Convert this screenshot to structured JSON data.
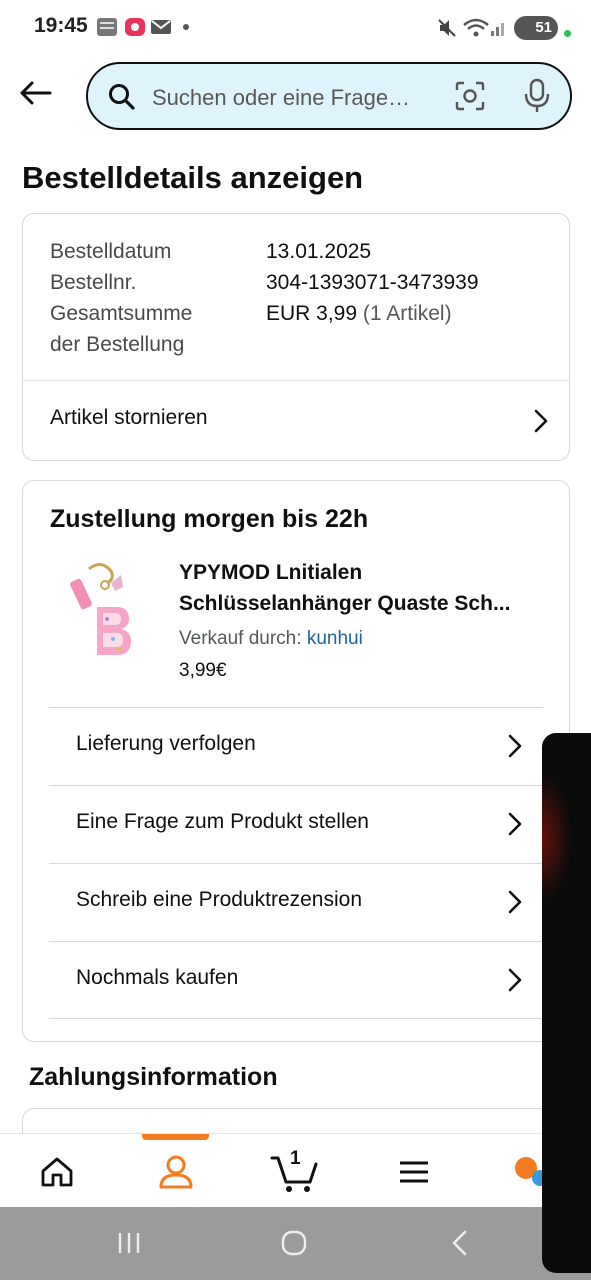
{
  "status_bar": {
    "time": "19:45",
    "battery": "51",
    "icons": [
      "news-icon",
      "video-app-icon",
      "mail-icon",
      "dot-icon",
      "mute-icon",
      "wifi-icon",
      "signal-icon",
      "battery-icon"
    ]
  },
  "header": {
    "search_placeholder": "Suchen oder eine Frage…"
  },
  "page": {
    "title": "Bestelldetails anzeigen"
  },
  "order": {
    "date_label": "Bestelldatum",
    "date_value": "13.01.2025",
    "number_label": "Bestellnr.",
    "number_value": "304-1393071-3473939",
    "total_label_1": "Gesamtsumme",
    "total_label_2": "der Bestellung",
    "total_value": "EUR 3,99",
    "total_items": "(1 Artikel)",
    "cancel_label": "Artikel stornieren"
  },
  "shipment": {
    "title": "Zustellung morgen bis 22h",
    "product_title_1": "YPYMOD Lnitialen",
    "product_title_2": "Schlüsselanhänger Quaste Sch...",
    "seller_label": "Verkauf durch:",
    "seller_name": "kunhui",
    "price": "3,99€",
    "actions": [
      {
        "label": "Lieferung verfolgen"
      },
      {
        "label": "Eine Frage zum Produkt stellen"
      },
      {
        "label": "Schreib eine Produktrezension"
      },
      {
        "label": "Nochmals kaufen"
      }
    ]
  },
  "payment": {
    "title": "Zahlungsinformation"
  },
  "bottom_nav": {
    "cart_count": "1",
    "active_tab": "account",
    "accent_color": "#f47b1f"
  },
  "colors": {
    "search_bg": "#dff3fb",
    "link": "#2162a1",
    "border": "#d5d9d9"
  }
}
